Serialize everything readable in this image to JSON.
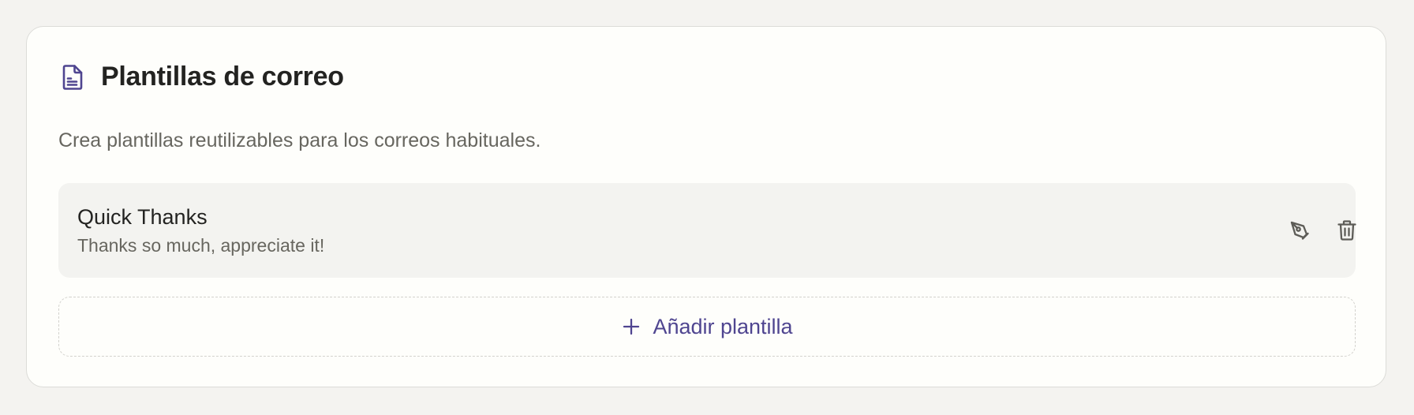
{
  "section": {
    "title": "Plantillas de correo",
    "description": "Crea plantillas reutilizables para los correos habituales.",
    "icon": "document-icon"
  },
  "templates": [
    {
      "name": "Quick Thanks",
      "body": "Thanks so much, appreciate it!"
    }
  ],
  "actions": {
    "edit_icon": "pen-nib-icon",
    "delete_icon": "trash-icon"
  },
  "add_button": {
    "label": "Añadir plantilla",
    "icon": "plus-icon"
  },
  "colors": {
    "accent": "#4f4590",
    "background": "#f4f3f0",
    "card": "#fefefb",
    "item": "#f3f3f0"
  }
}
